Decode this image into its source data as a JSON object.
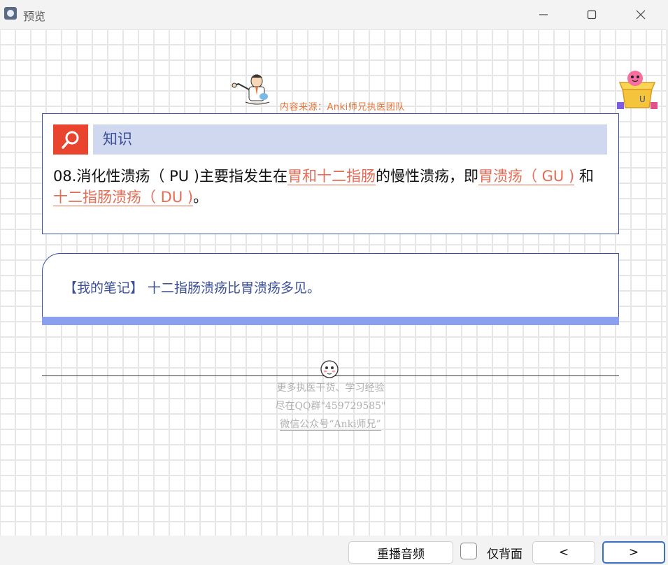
{
  "window": {
    "title": "预览",
    "icon": "app-icon"
  },
  "header": {
    "source": "内容来源：Anki师兄执医团队"
  },
  "knowledge": {
    "label": "知识",
    "text_1": "08.消化性溃疡（ PU )主要指发生在",
    "hl_1": "胃和十二指肠",
    "text_2": "的慢性溃疡，即",
    "hl_2": "胃溃疡（ GU )",
    "text_3": " 和",
    "hl_3": "十二指肠溃疡（ DU )",
    "text_4": "。"
  },
  "note": {
    "text": "【我的笔记】 十二指肠溃疡比胃溃疡多见。"
  },
  "footer": {
    "line1": "更多执医干货、学习经验",
    "line2": "尽在QQ群\"459729585\"",
    "line3": "微信公众号“Anki师兄”"
  },
  "toolbar": {
    "replay_label": "重播音频",
    "back_only_label": "仅背面",
    "back_only_checked": false,
    "prev_label": "<",
    "next_label": ">"
  },
  "colors": {
    "accent_red": "#e8442e",
    "highlight": "#e56b55",
    "blue_text": "#3a4f98",
    "head_bg": "#cfd8ee",
    "note_bar": "#8b9ff0"
  }
}
